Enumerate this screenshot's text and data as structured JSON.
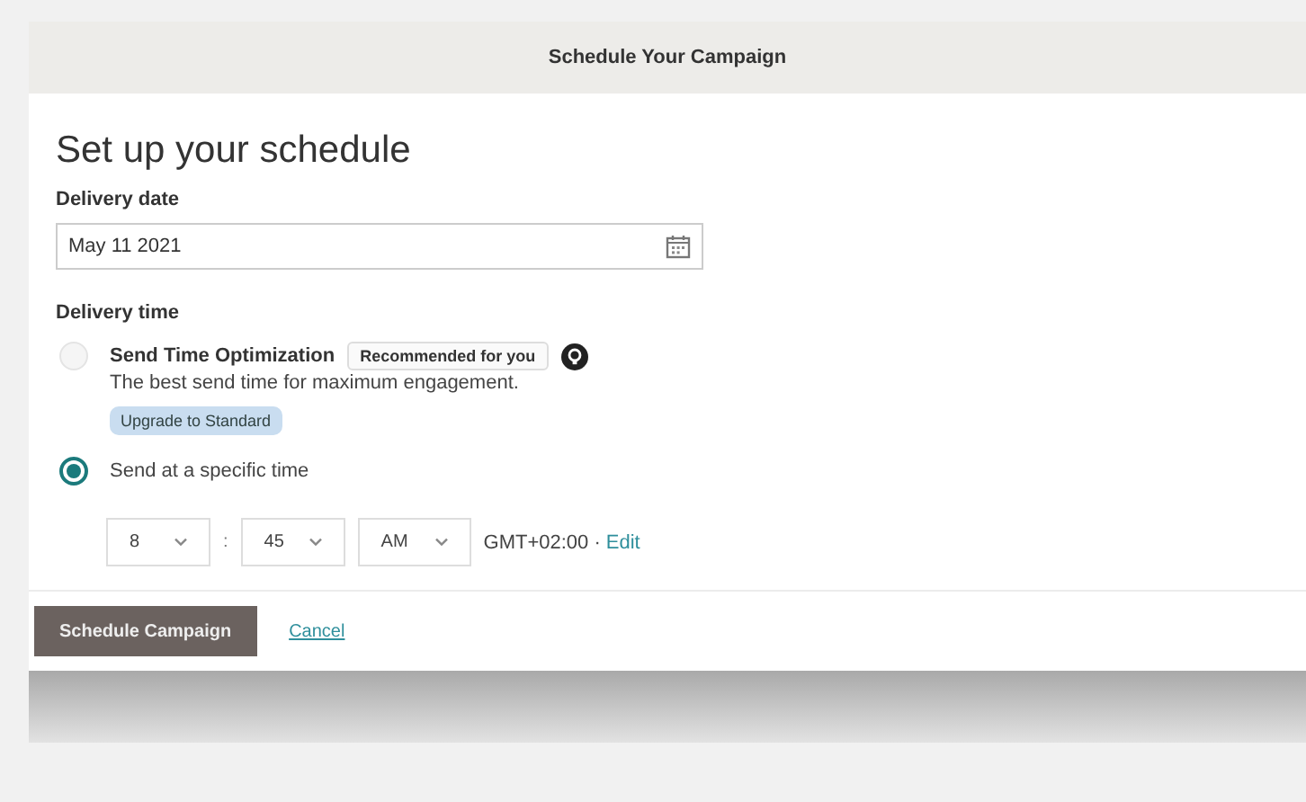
{
  "window": {
    "title": "Schedule Your Campaign"
  },
  "heading": "Set up your schedule",
  "delivery_date": {
    "label": "Delivery date",
    "value": "May 11 2021"
  },
  "delivery_time": {
    "label": "Delivery time",
    "options": [
      {
        "label": "Send Time Optimization",
        "selected": false,
        "disabled": true,
        "tag": "Recommended for you",
        "description": "The best send time for maximum engagement.",
        "badge": "Upgrade to Standard"
      },
      {
        "label": "Send at a specific time",
        "selected": true
      }
    ]
  },
  "time": {
    "hour": "8",
    "separator": ":",
    "minute": "45",
    "period": "AM",
    "timezone": "GMT+02:00 ·",
    "edit_link": "Edit"
  },
  "buttons": {
    "primary": "Schedule Campaign",
    "cancel": "Cancel"
  }
}
